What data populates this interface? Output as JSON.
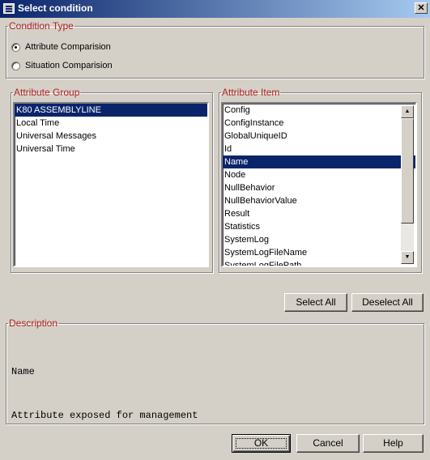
{
  "window": {
    "title": "Select condition",
    "close_glyph": "✕"
  },
  "condition_type": {
    "legend": "Condition Type",
    "options": [
      {
        "label": "Attribute Comparision",
        "selected": true
      },
      {
        "label": "Situation Comparision",
        "selected": false
      }
    ]
  },
  "attribute_group": {
    "legend": "Attribute Group",
    "items": [
      "K80 ASSEMBLYLINE",
      "Local Time",
      "Universal Messages",
      "Universal Time"
    ],
    "selected_index": 0
  },
  "attribute_item": {
    "legend": "Attribute Item",
    "items": [
      "Config",
      "ConfigInstance",
      "GlobalUniqueID",
      "Id",
      "Name",
      "Node",
      "NullBehavior",
      "NullBehaviorValue",
      "Result",
      "Statistics",
      "SystemLog",
      "SystemLogFileName",
      "SystemLogFilePath"
    ],
    "selected_index": 4
  },
  "buttons": {
    "select_all": "Select All",
    "deselect_all": "Deselect All",
    "ok": "OK",
    "cancel": "Cancel",
    "help": "Help"
  },
  "description": {
    "legend": "Description",
    "name": "Name",
    "text": "Attribute exposed for management"
  },
  "colors": {
    "selection": "#0a246a",
    "legend": "#b22222",
    "face": "#d4d0c8"
  }
}
